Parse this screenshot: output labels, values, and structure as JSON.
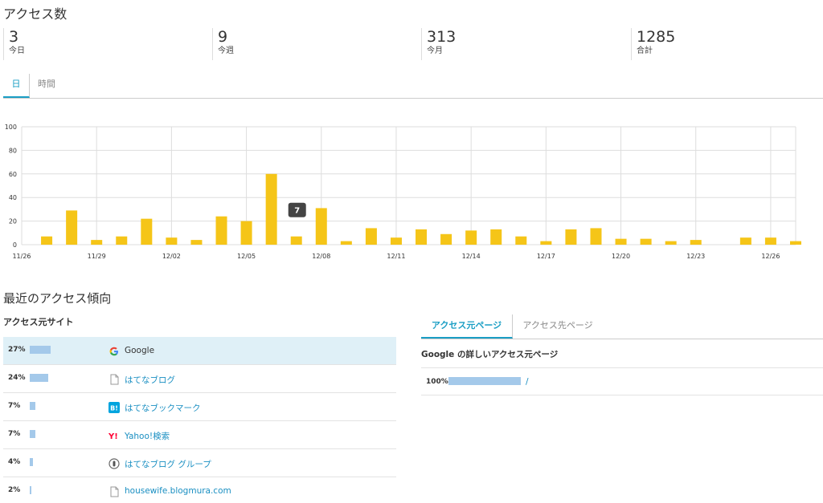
{
  "page_title": "アクセス数",
  "stats": [
    {
      "value": "3",
      "label": "今日"
    },
    {
      "value": "9",
      "label": "今週"
    },
    {
      "value": "313",
      "label": "今月"
    },
    {
      "value": "1285",
      "label": "合計"
    }
  ],
  "tabs": [
    {
      "label": "日",
      "active": true
    },
    {
      "label": "時間",
      "active": false
    }
  ],
  "chart_data": {
    "type": "bar",
    "ylim": [
      0,
      100
    ],
    "yticks": [
      0,
      20,
      40,
      60,
      80,
      100
    ],
    "grid": true,
    "bar_color": "#f5c518",
    "categories": [
      "11/26",
      "11/27",
      "11/28",
      "11/29",
      "11/30",
      "12/01",
      "12/02",
      "12/03",
      "12/04",
      "12/05",
      "12/06",
      "12/07",
      "12/08",
      "12/09",
      "12/10",
      "12/11",
      "12/12",
      "12/13",
      "12/14",
      "12/15",
      "12/16",
      "12/17",
      "12/18",
      "12/19",
      "12/20",
      "12/21",
      "12/22",
      "12/23",
      "12/24",
      "12/25",
      "12/26",
      "12/27"
    ],
    "xtick_labels": [
      "11/26",
      "11/29",
      "12/02",
      "12/05",
      "12/08",
      "12/11",
      "12/14",
      "12/17",
      "12/20",
      "12/23",
      "12/26"
    ],
    "values": [
      7,
      29,
      4,
      7,
      22,
      6,
      4,
      24,
      20,
      60,
      7,
      31,
      3,
      14,
      6,
      13,
      9,
      12,
      13,
      7,
      3,
      13,
      14,
      5,
      5,
      3,
      4,
      0,
      6,
      6,
      3
    ],
    "tooltip": {
      "category": "12/07",
      "value": "7"
    }
  },
  "recent_title": "最近のアクセス傾向",
  "referrers_title": "アクセス元サイト",
  "referrers": [
    {
      "percent": "27%",
      "share": 0.27,
      "name": "Google",
      "icon": "google-icon",
      "highlight": true
    },
    {
      "percent": "24%",
      "share": 0.24,
      "name": "はてなブログ",
      "icon": "document-icon",
      "highlight": false
    },
    {
      "percent": "7%",
      "share": 0.07,
      "name": "はてなブックマーク",
      "icon": "hatena-bookmark-icon",
      "highlight": false
    },
    {
      "percent": "7%",
      "share": 0.07,
      "name": "Yahoo!検索",
      "icon": "yahoo-icon",
      "highlight": false
    },
    {
      "percent": "4%",
      "share": 0.04,
      "name": "はてなブログ グループ",
      "icon": "group-icon",
      "highlight": false
    },
    {
      "percent": "2%",
      "share": 0.02,
      "name": "housewife.blogmura.com",
      "icon": "document-icon",
      "highlight": false
    }
  ],
  "page_tabs": [
    {
      "label": "アクセス元ページ",
      "active": true
    },
    {
      "label": "アクセス先ページ",
      "active": false
    }
  ],
  "detail_title": "Google の詳しいアクセス元ページ",
  "detail_rows": [
    {
      "percent": "100%",
      "share": 1.0,
      "path": "/"
    }
  ]
}
